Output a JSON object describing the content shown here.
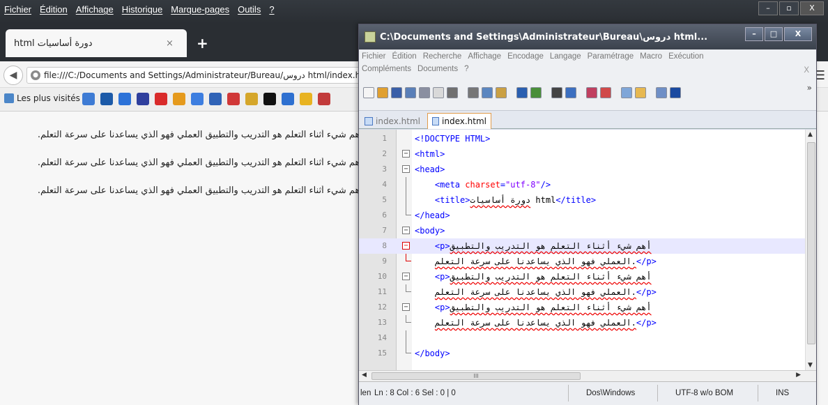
{
  "firefox": {
    "menu": [
      "Fichier",
      "Édition",
      "Affichage",
      "Historique",
      "Marque-pages",
      "Outils",
      "?"
    ],
    "tab": {
      "title": "دورة أساسيات html",
      "close": "×"
    },
    "new_tab": "+",
    "url": "file:///C:/Documents and Settings/Administrateur/Bureau/دروس html/index.htm",
    "bookmarks_first": "Les plus visités",
    "bookmark_icon_colors": [
      "#3e7bd4",
      "#1c5aa8",
      "#2c72d8",
      "#2f3f9d",
      "#d92b2b",
      "#e59a1d",
      "#3d7ee0",
      "#2f62b6",
      "#d03838",
      "#d5a62a",
      "#111111",
      "#2e70d0",
      "#e8b321",
      "#c23b3b"
    ],
    "paragraphs": [
      "أهم شيء أثناء التعلم هو التدريب والتطبيق العملي فهو الذي يساعدنا على سرعة التعلم.",
      "أهم شيء أثناء التعلم هو التدريب والتطبيق العملي فهو الذي يساعدنا على سرعة التعلم.",
      "أهم شيء أثناء التعلم هو التدريب والتطبيق العملي فهو الذي يساعدنا على سرعة التعلم."
    ],
    "win_buttons": {
      "min": "–",
      "max": "▫",
      "close": "X"
    }
  },
  "npp": {
    "title": "C:\\Documents and Settings\\Administrateur\\Bureau\\دروس html...",
    "menu_row1": [
      "Fichier",
      "Édition",
      "Recherche",
      "Affichage",
      "Encodage",
      "Langage",
      "Paramétrage",
      "Macro",
      "Exécution"
    ],
    "menu_row2": [
      "Compléments",
      "Documents",
      "?"
    ],
    "menu_close": "X",
    "toolbar_more": "»",
    "toolbar_icon_colors": [
      "#f5f5f5",
      "#e0a030",
      "#3a5fa8",
      "#5a7fb8",
      "#8a8fa0",
      "#d9d9d9",
      "#707070",
      "sep",
      "#777777",
      "#5b86c0",
      "#caa043",
      "sep",
      "#2a5fb0",
      "#4a8f3a",
      "sep",
      "#444444",
      "#3c6fc0",
      "sep",
      "#c04060",
      "#d04a4a",
      "sep",
      "#7fa6d8",
      "#e7b850",
      "sep",
      "#6f8fc6",
      "#1a4aa0"
    ],
    "tabs": [
      {
        "label": "index.html",
        "state": "inactive"
      },
      {
        "label": "index.html",
        "state": "active"
      }
    ],
    "lines": [
      {
        "n": "1",
        "fold": "",
        "parts": [
          [
            "tag",
            "<!DOCTYPE HTML>"
          ]
        ]
      },
      {
        "n": "2",
        "fold": "box-minus",
        "parts": [
          [
            "tag",
            "<html>"
          ]
        ]
      },
      {
        "n": "3",
        "fold": "box-minus",
        "parts": [
          [
            "tag",
            "<head>"
          ]
        ]
      },
      {
        "n": "4",
        "fold": "line",
        "parts": [
          [
            "plain",
            "    "
          ],
          [
            "tag",
            "<meta "
          ],
          [
            "attr",
            "charset"
          ],
          [
            "tag",
            "="
          ],
          [
            "val",
            "\"utf-8\""
          ],
          [
            "tag",
            "/>"
          ]
        ]
      },
      {
        "n": "5",
        "fold": "line",
        "parts": [
          [
            "plain",
            "    "
          ],
          [
            "tag",
            "<title>"
          ],
          [
            "ar",
            "دورة أساسيات"
          ],
          [
            "plain",
            " html"
          ],
          [
            "tag",
            "</title>"
          ]
        ]
      },
      {
        "n": "6",
        "fold": "end",
        "parts": [
          [
            "tag",
            "</head>"
          ]
        ]
      },
      {
        "n": "7",
        "fold": "box-minus",
        "parts": [
          [
            "tag",
            "<body>"
          ]
        ]
      },
      {
        "n": "8",
        "fold": "box-minus-red",
        "hl": true,
        "parts": [
          [
            "plain",
            "    "
          ],
          [
            "tag",
            "<p>"
          ],
          [
            "ar",
            "أهم شيء أثناء التعلم هو التدريب والتطبيق"
          ]
        ]
      },
      {
        "n": "9",
        "fold": "end-red",
        "parts": [
          [
            "plain",
            "    "
          ],
          [
            "ar",
            "العملي فهو الذي يساعدنا على سرعة التعلم."
          ],
          [
            "tag",
            "</p>"
          ]
        ]
      },
      {
        "n": "10",
        "fold": "box-minus",
        "parts": [
          [
            "plain",
            "    "
          ],
          [
            "tag",
            "<p>"
          ],
          [
            "ar",
            "أهم شيء أثناء التعلم هو التدريب والتطبيق"
          ]
        ]
      },
      {
        "n": "11",
        "fold": "end",
        "parts": [
          [
            "plain",
            "    "
          ],
          [
            "ar",
            "العملي فهو الذي يساعدنا على سرعة التعلم."
          ],
          [
            "tag",
            "</p>"
          ]
        ]
      },
      {
        "n": "12",
        "fold": "box-minus",
        "parts": [
          [
            "plain",
            "    "
          ],
          [
            "tag",
            "<p>"
          ],
          [
            "ar",
            "أهم شيء أثناء التعلم هو التدريب والتطبيق"
          ]
        ]
      },
      {
        "n": "13",
        "fold": "end",
        "parts": [
          [
            "plain",
            "    "
          ],
          [
            "ar",
            "العملي فهو الذي يساعدنا على سرعة التعلم."
          ],
          [
            "tag",
            "</p>"
          ]
        ]
      },
      {
        "n": "14",
        "fold": "line",
        "parts": []
      },
      {
        "n": "15",
        "fold": "end",
        "parts": [
          [
            "tag",
            "</body>"
          ]
        ]
      }
    ],
    "status": {
      "length": "len",
      "position": "Ln : 8   Col : 6   Sel : 0 | 0",
      "eol": "Dos\\Windows",
      "encoding": "UTF-8 w/o BOM",
      "mode": "INS"
    },
    "win_buttons": {
      "min": "–",
      "max": "□",
      "close": "X"
    },
    "scroll_mid": "III"
  }
}
